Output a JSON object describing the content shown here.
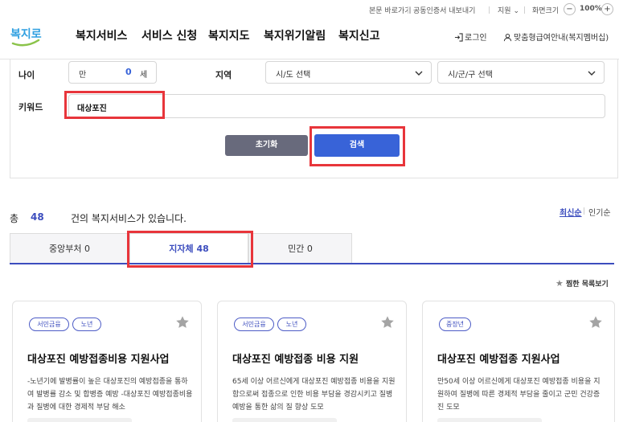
{
  "utility": {
    "skip": "본문 바로가기",
    "cert": "공동인증서 내보내기",
    "support": "지원",
    "zoom_label": "화면크기",
    "zoom_minus": "−",
    "zoom_value": "100%",
    "zoom_plus": "+"
  },
  "header": {
    "logo_text": "복지로",
    "nav": [
      "복지서비스",
      "서비스 신청",
      "복지지도",
      "복지위기알림",
      "복지신고"
    ],
    "login": "로그인",
    "guide": "맞춤형급여안내(복지멤버십)"
  },
  "search": {
    "age_label": "나이",
    "age_prefix": "만",
    "age_value": "0",
    "age_suffix": "세",
    "region_label": "지역",
    "sido_placeholder": "시/도 선택",
    "sigungu_placeholder": "시/군/구 선택",
    "keyword_label": "키워드",
    "keyword_value": "대상포진",
    "reset_label": "초기화",
    "search_label": "검색"
  },
  "results": {
    "total_prefix": "총",
    "total_count": "48",
    "total_suffix": "건의 복지서비스가 있습니다.",
    "sort_latest": "최신순",
    "sort_popular": "인기순",
    "tabs": [
      {
        "label": "중앙부처 0"
      },
      {
        "label": "지자체 48"
      },
      {
        "label": "민간 0"
      }
    ],
    "fav_list": "찜한 목록보기",
    "cards": [
      {
        "tags": [
          "서민금융",
          "노년"
        ],
        "title": "대상포진 예방접종비용 지원사업",
        "desc": "-노년기에 발병률이 높은 대상포진의 예방접종을 통하여 발병률 감소 및 합병증 예방 -대상포진 예방접종비용과 질병에 대한 경제적 부담 해소"
      },
      {
        "tags": [
          "서민금융",
          "노년"
        ],
        "title": "대상포진 예방접종 비용 지원",
        "desc": "65세 이상 어르신에게 대상포진 예방접종 비용을 지원함으로써 접종으로 인한 비용 부담을 경감시키고 질병 예방을 통한 삶의 질 향상 도모"
      },
      {
        "tags": [
          "중장년"
        ],
        "title": "대상포진 예방접종 지원사업",
        "desc": "만50세 이상 어르신에게 대상포진 예방접종 비용을 지원하여 질병에 따른 경제적 부담을 줄이고 군민 건강증진 도모"
      }
    ]
  },
  "colors": {
    "accent": "#3c4dbe",
    "search_button": "#3863d8",
    "reset_button": "#686a7c",
    "highlight": "#e8353b"
  }
}
